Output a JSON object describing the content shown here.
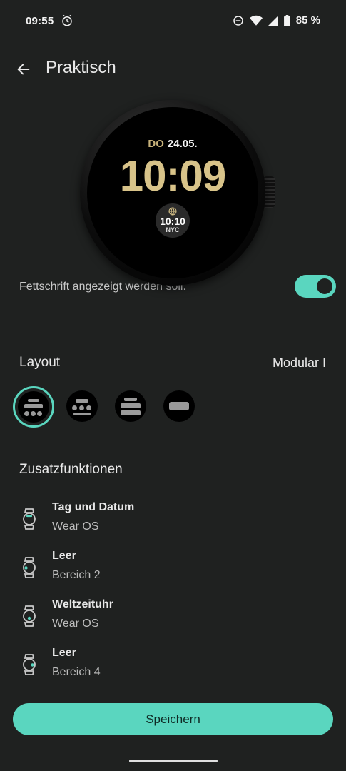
{
  "status_bar": {
    "time": "09:55",
    "battery": "85 %",
    "icons": [
      "alarm-icon",
      "do-not-disturb-icon",
      "wifi-icon",
      "signal-icon",
      "battery-icon"
    ]
  },
  "header": {
    "title": "Praktisch",
    "back_icon": "arrow-back-icon"
  },
  "watch_preview": {
    "day": "DO",
    "date": "24.05.",
    "time": "10:09",
    "world_clock": {
      "time": "10:10",
      "city": "NYC",
      "icon": "globe-icon"
    }
  },
  "partial_setting": {
    "description": "Fettschrift angezeigt werden soll.",
    "toggle_on": true
  },
  "layout": {
    "label": "Layout",
    "value": "Modular I",
    "options": [
      {
        "name": "layout-modular-1",
        "selected": true
      },
      {
        "name": "layout-modular-2",
        "selected": false
      },
      {
        "name": "layout-modular-3",
        "selected": false
      },
      {
        "name": "layout-minimal",
        "selected": false
      }
    ]
  },
  "complications": {
    "label": "Zusatzfunktionen",
    "items": [
      {
        "title": "Tag und Datum",
        "subtitle": "Wear OS",
        "icon": "watch-complication-top-icon"
      },
      {
        "title": "Leer",
        "subtitle": "Bereich 2",
        "icon": "watch-complication-left-icon"
      },
      {
        "title": "Weltzeituhr",
        "subtitle": "Wear OS",
        "icon": "watch-complication-bottom-icon"
      },
      {
        "title": "Leer",
        "subtitle": "Bereich 4",
        "icon": "watch-complication-right-icon"
      }
    ]
  },
  "save_button": {
    "label": "Speichern"
  },
  "colors": {
    "accent": "#5ad6bf",
    "background": "#1f2120",
    "gold": "#d8c389"
  }
}
